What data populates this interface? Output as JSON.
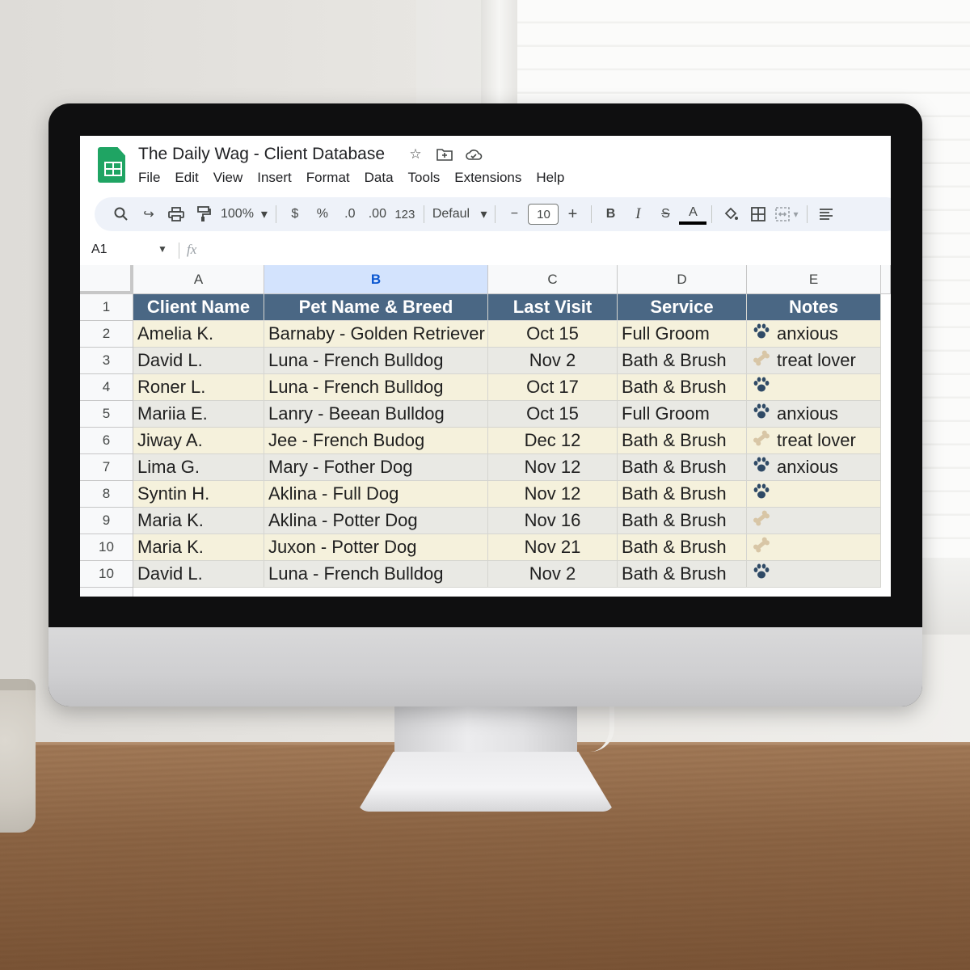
{
  "app": {
    "title": "The Daily Wag - Client Database",
    "menu": [
      "File",
      "Edit",
      "View",
      "Insert",
      "Format",
      "Data",
      "Tools",
      "Extensions",
      "Help"
    ],
    "title_icons": [
      "star-icon",
      "folder-icon",
      "cloud-icon"
    ]
  },
  "toolbar": {
    "zoom": "100%",
    "currency": "$",
    "percent": "%",
    "decrease_decimal": ".0",
    "increase_decimal": ".00",
    "number_format": "123",
    "font": "Defaul",
    "font_size": "10",
    "minus": "−",
    "plus": "+",
    "bold": "B",
    "italic": "I",
    "strike": "S",
    "text_color": "A"
  },
  "formula_bar": {
    "name_box": "A1",
    "fx": "fx"
  },
  "grid": {
    "columns": [
      "A",
      "B",
      "C",
      "D",
      "E"
    ],
    "selected_column": "B",
    "row_numbers": [
      "1",
      "2",
      "3",
      "4",
      "5",
      "6",
      "7",
      "8",
      "9",
      "10",
      "10"
    ],
    "header": [
      "Client Name",
      "Pet Name & Breed",
      "Last Visit",
      "Service",
      "Notes"
    ],
    "rows": [
      {
        "client": "Amelia K.",
        "pet": "Barnaby - Golden Retriever",
        "visit": "Oct 15",
        "service": "Full Groom",
        "note_icon": "paw",
        "note": "anxious"
      },
      {
        "client": "David L.",
        "pet": "Luna - French Bulldog",
        "visit": "Nov 2",
        "service": "Bath & Brush",
        "note_icon": "bone",
        "note": "treat lover"
      },
      {
        "client": "Roner L.",
        "pet": "Luna - French Bulldog",
        "visit": "Oct 17",
        "service": "Bath & Brush",
        "note_icon": "paw",
        "note": ""
      },
      {
        "client": "Mariia E.",
        "pet": "Lanry - Beean Bulldog",
        "visit": "Oct 15",
        "service": "Full Groom",
        "note_icon": "paw",
        "note": "anxious"
      },
      {
        "client": "Jiway A.",
        "pet": "Jee - French Budog",
        "visit": "Dec 12",
        "service": "Bath & Brush",
        "note_icon": "bone",
        "note": "treat lover"
      },
      {
        "client": "Lima G.",
        "pet": "Mary - Fother Dog",
        "visit": "Nov 12",
        "service": "Bath & Brush",
        "note_icon": "paw",
        "note": "anxious"
      },
      {
        "client": "Syntin H.",
        "pet": "Aklina - Full Dog",
        "visit": "Nov 12",
        "service": "Bath & Brush",
        "note_icon": "paw",
        "note": ""
      },
      {
        "client": "Maria K.",
        "pet": "Aklina - Potter Dog",
        "visit": "Nov 16",
        "service": "Bath & Brush",
        "note_icon": "bone",
        "note": ""
      },
      {
        "client": "Maria K.",
        "pet": "Juxon - Potter Dog",
        "visit": "Nov 21",
        "service": "Bath & Brush",
        "note_icon": "bone",
        "note": ""
      },
      {
        "client": "David L.",
        "pet": "Luna - French Bulldog",
        "visit": "Nov 2",
        "service": "Bath & Brush",
        "note_icon": "paw",
        "note": ""
      }
    ]
  },
  "colors": {
    "header_fill": "#4a6784",
    "row_even": "#f5f1dc",
    "row_odd": "#e9e9e4",
    "selected_column": "#d3e3fd",
    "sheets_green": "#1fa463"
  }
}
